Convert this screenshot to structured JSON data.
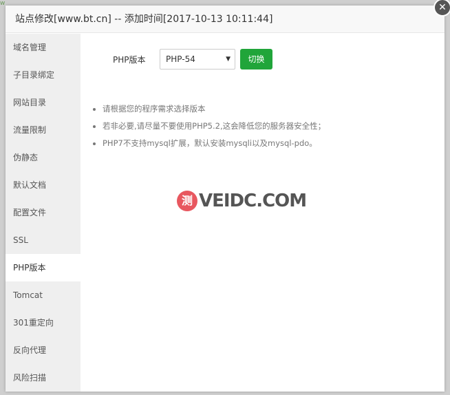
{
  "backdrop": {
    "hint_text": "w"
  },
  "modal": {
    "title": "站点修改[www.bt.cn] -- 添加时间[2017-10-13 10:11:44]",
    "close_icon": "close-icon"
  },
  "sidebar": {
    "active_index": 8,
    "items": [
      {
        "label": "域名管理"
      },
      {
        "label": "子目录绑定"
      },
      {
        "label": "网站目录"
      },
      {
        "label": "流量限制"
      },
      {
        "label": "伪静态"
      },
      {
        "label": "默认文档"
      },
      {
        "label": "配置文件"
      },
      {
        "label": "SSL"
      },
      {
        "label": "PHP版本"
      },
      {
        "label": "Tomcat"
      },
      {
        "label": "301重定向"
      },
      {
        "label": "反向代理"
      },
      {
        "label": "风险扫描"
      }
    ]
  },
  "php": {
    "label": "PHP版本",
    "selected_version": "PHP-54",
    "switch_button": "切换"
  },
  "notes": [
    "请根据您的程序需求选择版本",
    "若非必要,请尽量不要使用PHP5.2,这会降低您的服务器安全性；",
    "PHP7不支持mysql扩展，默认安装mysqli以及mysql-pdo。"
  ],
  "watermark": {
    "badge": "测",
    "text": "VEIDC.COM"
  },
  "colors": {
    "primary_green": "#20a53a",
    "sidebar_bg": "#efefef",
    "watermark_red": "#e8575f"
  }
}
